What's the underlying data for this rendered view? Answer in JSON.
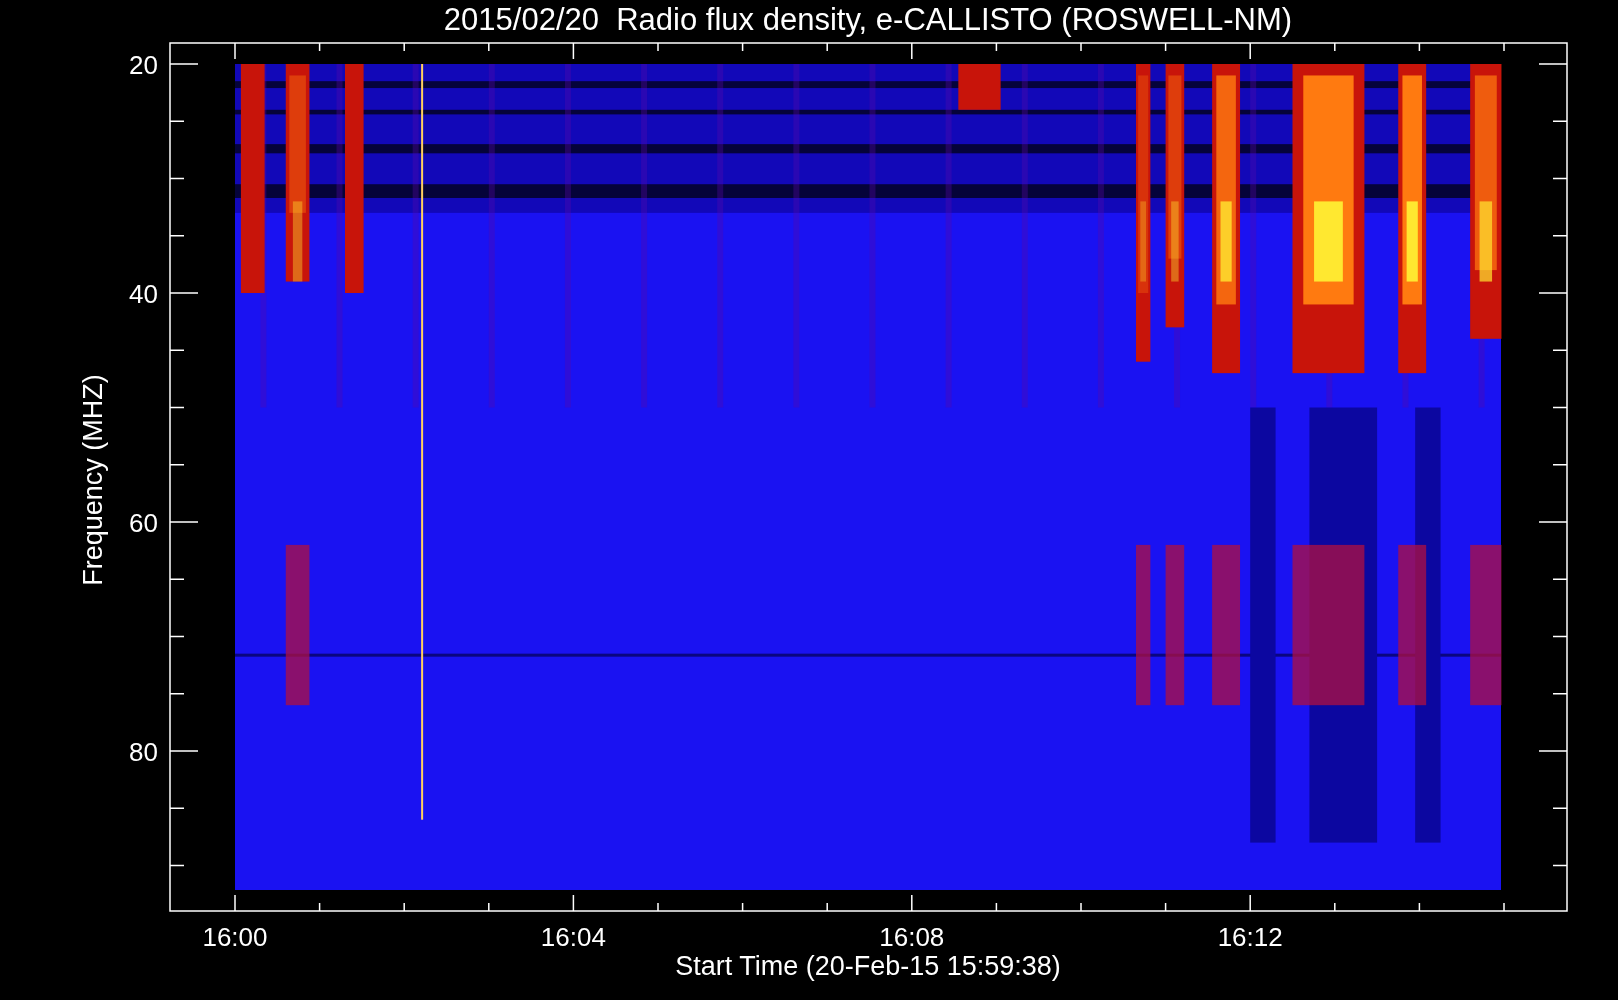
{
  "chart": {
    "title": "2015/02/20  Radio flux density, e-CALLISTO (ROSWELL-NM)",
    "xlabel": "Start Time (20-Feb-15 15:59:38)",
    "ylabel": "Frequency (MHZ)",
    "xticks": [
      "16:00",
      "16:04",
      "16:08",
      "16:12"
    ],
    "yticks": [
      "20",
      "40",
      "60",
      "80"
    ]
  }
}
